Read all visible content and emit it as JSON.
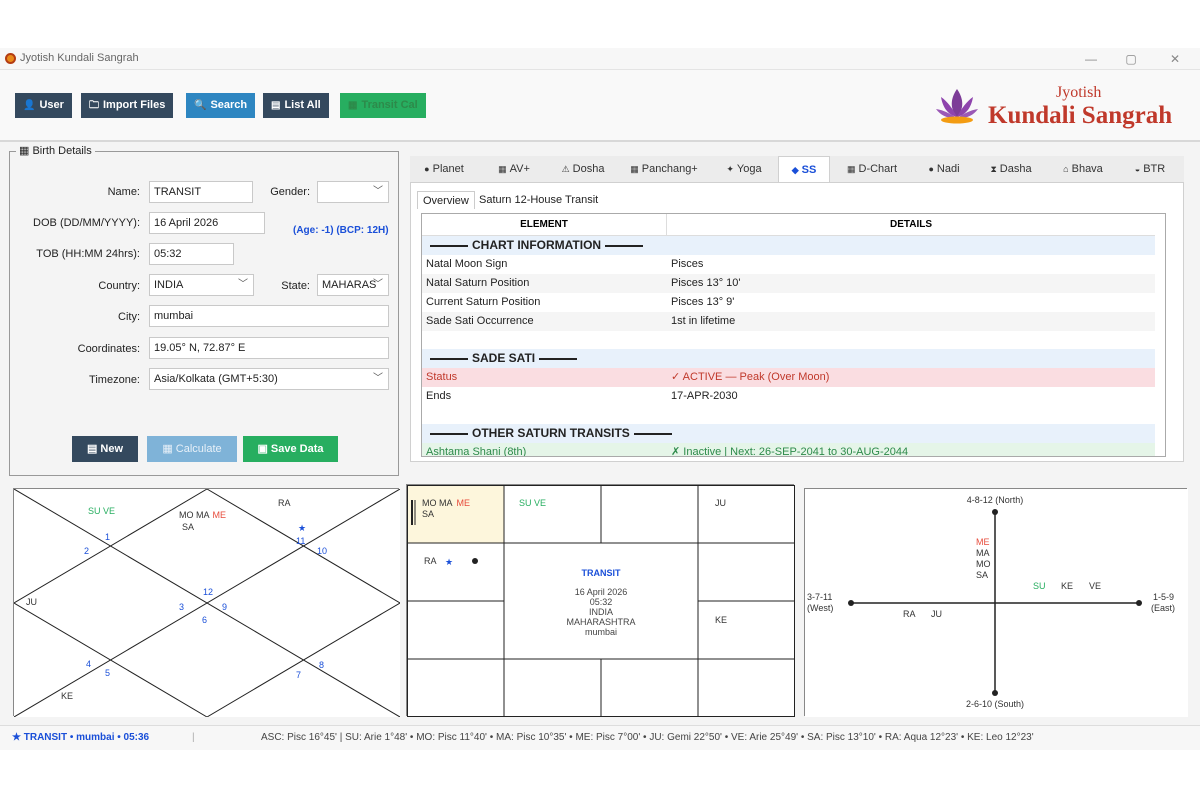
{
  "window": {
    "title": "Jyotish Kundali Sangrah",
    "min": "—",
    "max": "▢",
    "close": "✕"
  },
  "toolbar": {
    "user": "User",
    "import": "Import Files",
    "search": "Search",
    "list_all": "List All",
    "transit_cal": "Transit Cal",
    "logo_small": "Jyotish",
    "logo_big": "Kundali Sangrah"
  },
  "birth": {
    "title": "Birth Details",
    "name_label": "Name:",
    "name": "TRANSIT",
    "gender_label": "Gender:",
    "gender": "",
    "dob_label": "DOB (DD/MM/YYYY):",
    "dob": "16 April 2026",
    "age": "(Age: -1) (BCP: 12H)",
    "tob_label": "TOB (HH:MM 24hrs):",
    "tob": "05:32",
    "country_label": "Country:",
    "country": "INDIA",
    "state_label": "State:",
    "state": "MAHARAS",
    "city_label": "City:",
    "city": "mumbai",
    "coord_label": "Coordinates:",
    "coord": "19.05° N, 72.87° E",
    "tz_label": "Timezone:",
    "tz": "Asia/Kolkata (GMT+5:30)",
    "new": "New",
    "calculate": "Calculate",
    "save": "Save Data"
  },
  "tabs": [
    "Planet",
    "AV+",
    "Dosha",
    "Panchang+",
    "Yoga",
    "SS",
    "D-Chart",
    "Nadi",
    "Dasha",
    "Bhava",
    "BTR"
  ],
  "subtabs": [
    "Overview",
    "Saturn 12-House Transit"
  ],
  "table": {
    "headers": [
      "ELEMENT",
      "DETAILS"
    ],
    "sec_chart": "CHART INFORMATION",
    "rows1": [
      [
        "Natal Moon Sign",
        "Pisces"
      ],
      [
        "Natal Saturn Position",
        "Pisces 13° 10'"
      ],
      [
        "Current Saturn Position",
        "Pisces 13° 9'"
      ],
      [
        "Sade Sati Occurrence",
        "1st in lifetime"
      ]
    ],
    "sec_sade": "SADE SATI",
    "status": [
      "Status",
      "✓ ACTIVE — Peak (Over Moon)"
    ],
    "ends": [
      "Ends",
      "17-APR-2030"
    ],
    "sec_other": "OTHER SATURN TRANSITS",
    "ashtama": [
      "Ashtama Shani (8th)",
      "✗ Inactive | Next: 26-SEP-2041 to 30-AUG-2044"
    ]
  },
  "north": {
    "h1": "SU  VE",
    "h12a": "MO  MA",
    "h12b": "ME",
    "h12c": "SA",
    "h11": "RA",
    "h3": "JU",
    "h6": "KE",
    "nums": [
      "1",
      "2",
      "3",
      "4",
      "5",
      "6",
      "7",
      "8",
      "9",
      "10",
      "11",
      "12"
    ]
  },
  "south": {
    "pisces1": "MO  MA",
    "pisces_me": "ME",
    "pisces2": "SA",
    "aries": "SU  VE",
    "gemini": "JU",
    "aquarius": "RA",
    "leo": "KE",
    "c_title": "TRANSIT",
    "c_date": "16 April 2026",
    "c_time": "05:32",
    "c_country": "INDIA",
    "c_state": "MAHARASHTRA",
    "c_city": "mumbai"
  },
  "east": {
    "north": "4-8-12 (North)",
    "south": "2-6-10 (South)",
    "west1": "3-7-11",
    "west2": "(West)",
    "east1": "1-5-9",
    "east2": "(East)",
    "me": "ME",
    "ma": "MA",
    "mo": "MO",
    "sa": "SA",
    "su": "SU",
    "ke": "KE",
    "ve": "VE",
    "ra": "RA",
    "ju": "JU"
  },
  "status": {
    "left": "★ TRANSIT • mumbai • 05:36",
    "sep": "|",
    "right": "ASC: Pisc 16°45'  |  SU: Arie 1°48'  •  MO: Pisc 11°40'  •  MA: Pisc 10°35'  •  ME: Pisc 7°00'  •  JU: Gemi 22°50'  •  VE: Arie 25°49'  •  SA: Pisc 13°10'  •  RA: Aqua 12°23'  •  KE: Leo 12°23'"
  },
  "colors": {
    "dark": "#34495e",
    "blue": "#2e86c1",
    "green": "#27ae60",
    "red": "#c0392b",
    "accent": "#1a4fd8"
  }
}
